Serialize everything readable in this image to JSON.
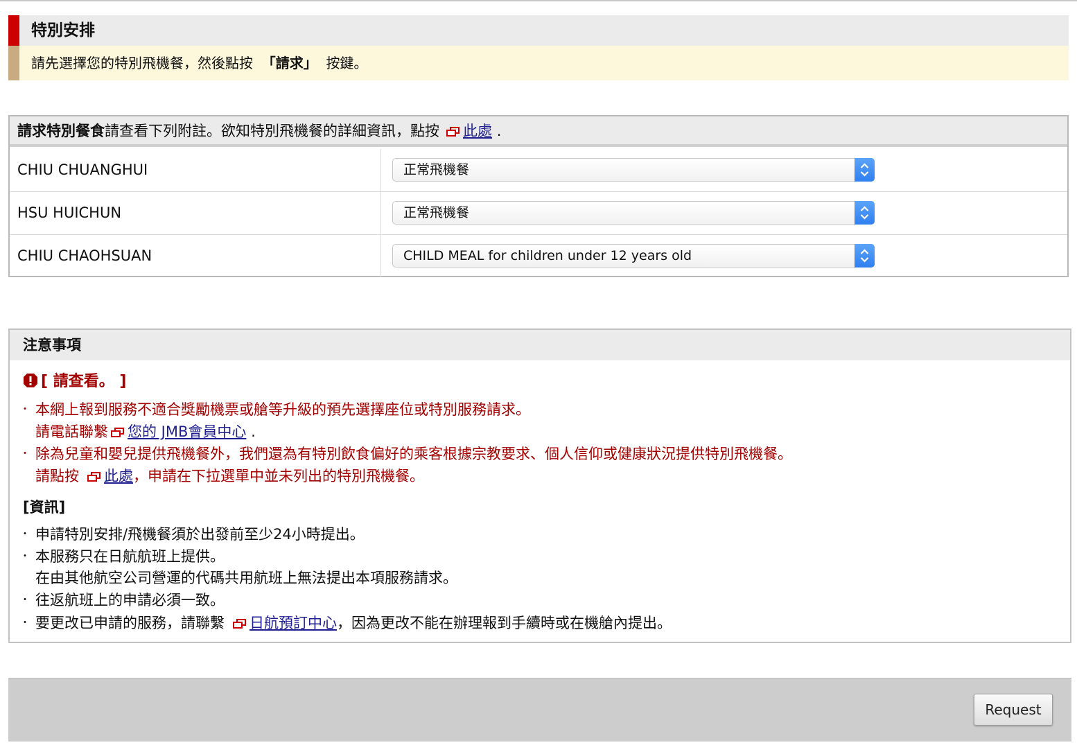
{
  "header": {
    "title": "特別安排",
    "instruction_pre": "請先選擇您的特別飛機餐，然後點按",
    "instruction_bold": "「請求」",
    "instruction_post": "按鍵。"
  },
  "meal_table": {
    "heading_bold": "請求特別餐食",
    "heading_text": "請查看下列附註。欲知特別飛機餐的詳細資訊，點按",
    "heading_link": "此處",
    "heading_end": ".",
    "passengers": [
      {
        "name": "CHIU CHUANGHUI",
        "meal": "正常飛機餐"
      },
      {
        "name": "HSU HUICHUN",
        "meal": "正常飛機餐"
      },
      {
        "name": "CHIU CHAOHSUAN",
        "meal": "CHILD MEAL for children under 12 years old"
      }
    ]
  },
  "notes": {
    "title": "注意事項",
    "alert_title": "[ 請查看。 ]",
    "alert_items": [
      {
        "line1": "本網上報到服務不適合獎勵機票或艙等升級的預先選擇座位或特別服務請求。",
        "line2_pre": "請電話聯繫",
        "line2_link": "您的 JMB會員中心",
        "line2_post": "."
      },
      {
        "line1": "除為兒童和嬰兒提供飛機餐外，我們還為有特別飲食偏好的乘客根據宗教要求、個人信仰或健康狀況提供特別飛機餐。",
        "line2_pre": "請點按",
        "line2_link": "此處",
        "line2_post": "，申請在下拉選單中並未列出的特別飛機餐。"
      }
    ],
    "info_title": "[資訊]",
    "info_items": {
      "item1": "申請特別安排/飛機餐須於出發前至少24小時提出。",
      "item2_line1": "本服務只在日航航班上提供。",
      "item2_line2": "在由其他航空公司營運的代碼共用航班上無法提出本項服務請求。",
      "item3": "往返航班上的申請必須一致。",
      "item4_pre": "要更改已申請的服務，請聯繫",
      "item4_link": "日航預訂中心",
      "item4_post": "，因為更改不能在辦理報到手續時或在機艙內提出。"
    },
    "bullet": "・"
  },
  "footer": {
    "request_label": "Request"
  },
  "colors": {
    "accent_red": "#cc0000",
    "alert_text": "#a30000",
    "link": "#1f1f8f",
    "select_arrow": "#2f7ff0"
  },
  "icons": {
    "external_link": "new-window-icon",
    "alert": "exclamation-icon",
    "select": "updown-chevron-icon"
  }
}
